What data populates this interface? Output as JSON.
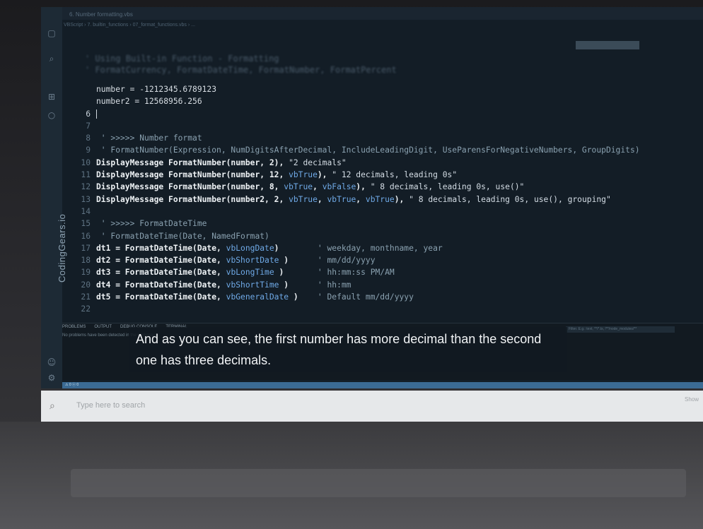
{
  "window": {
    "title_tab": "6. Number formatting.vbs",
    "breadcrumb": "VBScript › 7. builtin_functions › 07_format_functions.vbs › ...",
    "faded_heading": "' Using Built-in Function - Formatting",
    "faded_subheading": "' FormatCurrency, FormatDateTime, FormatNumber, FormatPercent"
  },
  "brand": {
    "name": "CodingGears.io"
  },
  "editor": {
    "lines": [
      {
        "n": "",
        "parts": [
          {
            "t": "number = -1212345.6789123",
            "c": "plain"
          }
        ]
      },
      {
        "n": "",
        "parts": [
          {
            "t": "number2 = 12568956.256",
            "c": "plain"
          }
        ]
      },
      {
        "n": "6",
        "cursor": true,
        "parts": []
      },
      {
        "n": "7",
        "parts": []
      },
      {
        "n": "8",
        "parts": [
          {
            "t": " ' >>>>> Number format",
            "c": "cm"
          }
        ]
      },
      {
        "n": "9",
        "parts": [
          {
            "t": " ' FormatNumber(Expression, NumDigitsAfterDecimal, IncludeLeadingDigit, UseParensForNegativeNumbers, GroupDigits)",
            "c": "cm"
          }
        ]
      },
      {
        "n": "10",
        "parts": [
          {
            "t": "DisplayMessage FormatNumber(number, 2), ",
            "c": "bold"
          },
          {
            "t": "\"2 decimals\"",
            "c": "str"
          }
        ]
      },
      {
        "n": "11",
        "parts": [
          {
            "t": "DisplayMessage FormatNumber(number, 12, ",
            "c": "bold"
          },
          {
            "t": "vbTrue",
            "c": "kw"
          },
          {
            "t": "), ",
            "c": "bold"
          },
          {
            "t": "\" 12 decimals, leading 0s\"",
            "c": "str"
          }
        ]
      },
      {
        "n": "12",
        "parts": [
          {
            "t": "DisplayMessage FormatNumber(number, 8, ",
            "c": "bold"
          },
          {
            "t": "vbTrue",
            "c": "kw"
          },
          {
            "t": ", ",
            "c": "bold"
          },
          {
            "t": "vbFalse",
            "c": "kw"
          },
          {
            "t": "), ",
            "c": "bold"
          },
          {
            "t": "\" 8 decimals, leading 0s, use()\"",
            "c": "str"
          }
        ]
      },
      {
        "n": "13",
        "parts": [
          {
            "t": "DisplayMessage FormatNumber(number2, 2, ",
            "c": "bold"
          },
          {
            "t": "vbTrue",
            "c": "kw"
          },
          {
            "t": ", ",
            "c": "bold"
          },
          {
            "t": "vbTrue",
            "c": "kw"
          },
          {
            "t": ", ",
            "c": "bold"
          },
          {
            "t": "vbTrue",
            "c": "kw"
          },
          {
            "t": "), ",
            "c": "bold"
          },
          {
            "t": "\" 8 decimals, leading 0s, use(), grouping\"",
            "c": "str"
          }
        ]
      },
      {
        "n": "14",
        "parts": []
      },
      {
        "n": "15",
        "parts": [
          {
            "t": " ' >>>>> FormatDateTime",
            "c": "cm"
          }
        ]
      },
      {
        "n": "16",
        "parts": [
          {
            "t": " ' FormatDateTime(Date, NamedFormat)",
            "c": "cm"
          }
        ]
      },
      {
        "n": "17",
        "parts": [
          {
            "t": "dt1 = FormatDateTime(Date, ",
            "c": "bold"
          },
          {
            "t": "vbLongDate",
            "c": "kw"
          },
          {
            "t": ")       ",
            "c": "bold"
          },
          {
            "t": " ' weekday, monthname, year",
            "c": "cm"
          }
        ]
      },
      {
        "n": "18",
        "parts": [
          {
            "t": "dt2 = FormatDateTime(Date, ",
            "c": "bold"
          },
          {
            "t": "vbShortDate",
            "c": "kw"
          },
          {
            "t": " )     ",
            "c": "bold"
          },
          {
            "t": " ' mm/dd/yyyy",
            "c": "cm"
          }
        ]
      },
      {
        "n": "19",
        "parts": [
          {
            "t": "dt3 = FormatDateTime(Date, ",
            "c": "bold"
          },
          {
            "t": "vbLongTime",
            "c": "kw"
          },
          {
            "t": " )      ",
            "c": "bold"
          },
          {
            "t": " ' hh:mm:ss PM/AM",
            "c": "cm"
          }
        ]
      },
      {
        "n": "20",
        "parts": [
          {
            "t": "dt4 = FormatDateTime(Date, ",
            "c": "bold"
          },
          {
            "t": "vbShortTime",
            "c": "kw"
          },
          {
            "t": " )     ",
            "c": "bold"
          },
          {
            "t": " ' hh:mm",
            "c": "cm"
          }
        ]
      },
      {
        "n": "21",
        "parts": [
          {
            "t": "dt5 = FormatDateTime(Date, ",
            "c": "bold"
          },
          {
            "t": "vbGeneralDate",
            "c": "kw"
          },
          {
            "t": " )   ",
            "c": "bold"
          },
          {
            "t": " ' Default mm/dd/yyyy",
            "c": "cm"
          }
        ]
      },
      {
        "n": "22",
        "parts": []
      }
    ]
  },
  "panel": {
    "tabs": [
      "PROBLEMS",
      "OUTPUT",
      "DEBUG CONSOLE",
      "TERMINAL"
    ],
    "message": "No problems have been detected in the workspace.",
    "filter_placeholder": "Filter. E.g.: text, **/*.ts, !**/node_modules/**"
  },
  "subtitle": "And as you can see, the first number has more decimal than the second one has three decimals.",
  "statusbar": {
    "text": "⚠ 0  ⓧ 0"
  },
  "taskbar": {
    "search_text": "Type here to search",
    "right_text": "Show"
  },
  "colors": {
    "editor_bg": "#131d26",
    "keyword": "#6fa9e6",
    "comment": "#8aa1b0",
    "statusbar": "#3b6b94"
  }
}
